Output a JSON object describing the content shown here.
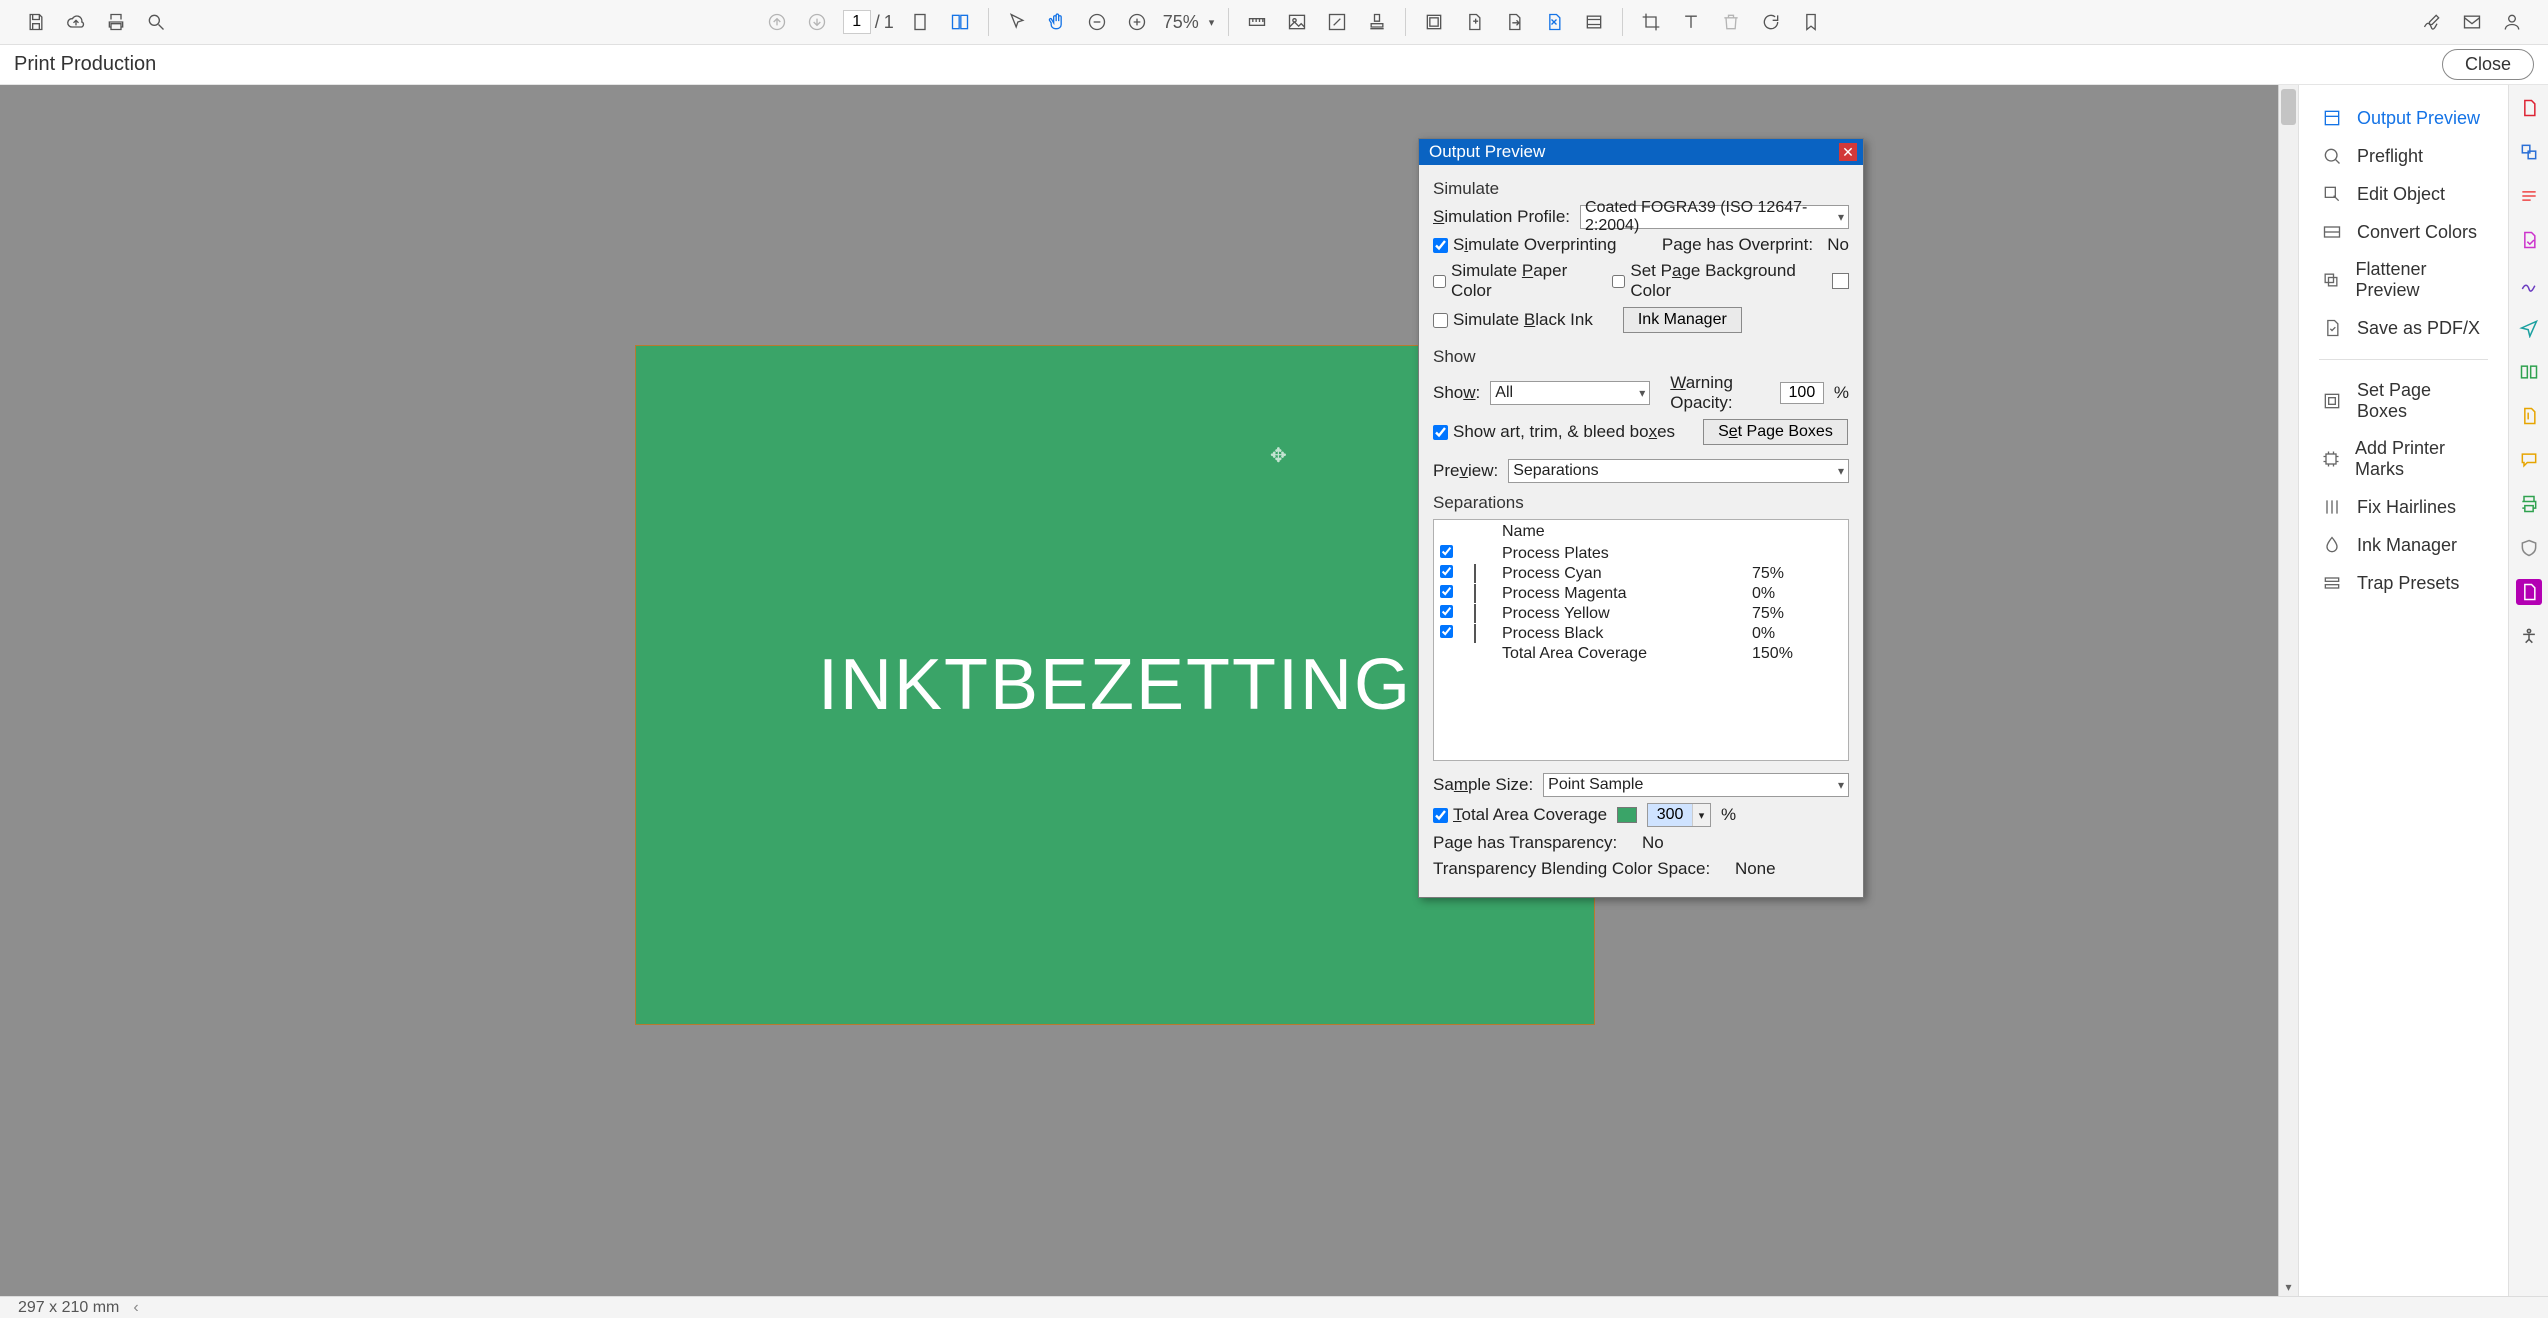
{
  "toolbar": {
    "page_current": "1",
    "page_total": "1",
    "zoom": "75%"
  },
  "subheader": {
    "title": "Print Production",
    "close": "Close"
  },
  "document": {
    "text": "INKTBEZETTING"
  },
  "status": {
    "dims": "297 x 210 mm"
  },
  "right_panel": {
    "items": [
      {
        "label": "Output Preview"
      },
      {
        "label": "Preflight"
      },
      {
        "label": "Edit Object"
      },
      {
        "label": "Convert Colors"
      },
      {
        "label": "Flattener Preview"
      },
      {
        "label": "Save as PDF/X"
      },
      {
        "label": "Set Page Boxes"
      },
      {
        "label": "Add Printer Marks"
      },
      {
        "label": "Fix Hairlines"
      },
      {
        "label": "Ink Manager"
      },
      {
        "label": "Trap Presets"
      }
    ]
  },
  "dialog": {
    "title": "Output Preview",
    "simulate": {
      "section": "Simulate",
      "profile_label": "Simulation Profile:",
      "profile_value": "Coated FOGRA39 (ISO 12647-2:2004)",
      "sim_overprint": "Simulate Overprinting",
      "page_has_overprint_label": "Page has Overprint:",
      "page_has_overprint_value": "No",
      "sim_paper": "Simulate Paper Color",
      "set_bg": "Set Page Background Color",
      "sim_black": "Simulate Black Ink",
      "ink_manager_btn": "Ink Manager"
    },
    "show": {
      "section": "Show",
      "show_label": "Show:",
      "show_value": "All",
      "warning_label": "Warning Opacity:",
      "warning_value": "100",
      "warning_unit": "%",
      "show_art": "Show art, trim, & bleed boxes",
      "set_page_boxes": "Set Page Boxes"
    },
    "preview": {
      "label": "Preview:",
      "value": "Separations"
    },
    "separations": {
      "section": "Separations",
      "col_name": "Name",
      "rows": [
        {
          "name": "Process Plates",
          "color": "",
          "pct": ""
        },
        {
          "name": "Process Cyan",
          "color": "#00d7ff",
          "pct": "75%"
        },
        {
          "name": "Process Magenta",
          "color": "#ff00c3",
          "pct": "0%"
        },
        {
          "name": "Process Yellow",
          "color": "#ffff00",
          "pct": "75%"
        },
        {
          "name": "Process Black",
          "color": "#000000",
          "pct": "0%"
        },
        {
          "name": "Total Area Coverage",
          "color": "",
          "pct": "150%"
        }
      ],
      "sample_label": "Sample Size:",
      "sample_value": "Point Sample",
      "tac_label": "Total Area Coverage",
      "tac_value": "300",
      "tac_unit": "%",
      "tac_swatch": "#3aa468",
      "transp_label": "Page has Transparency:",
      "transp_value": "No",
      "blend_label": "Transparency Blending Color Space:",
      "blend_value": "None"
    }
  }
}
